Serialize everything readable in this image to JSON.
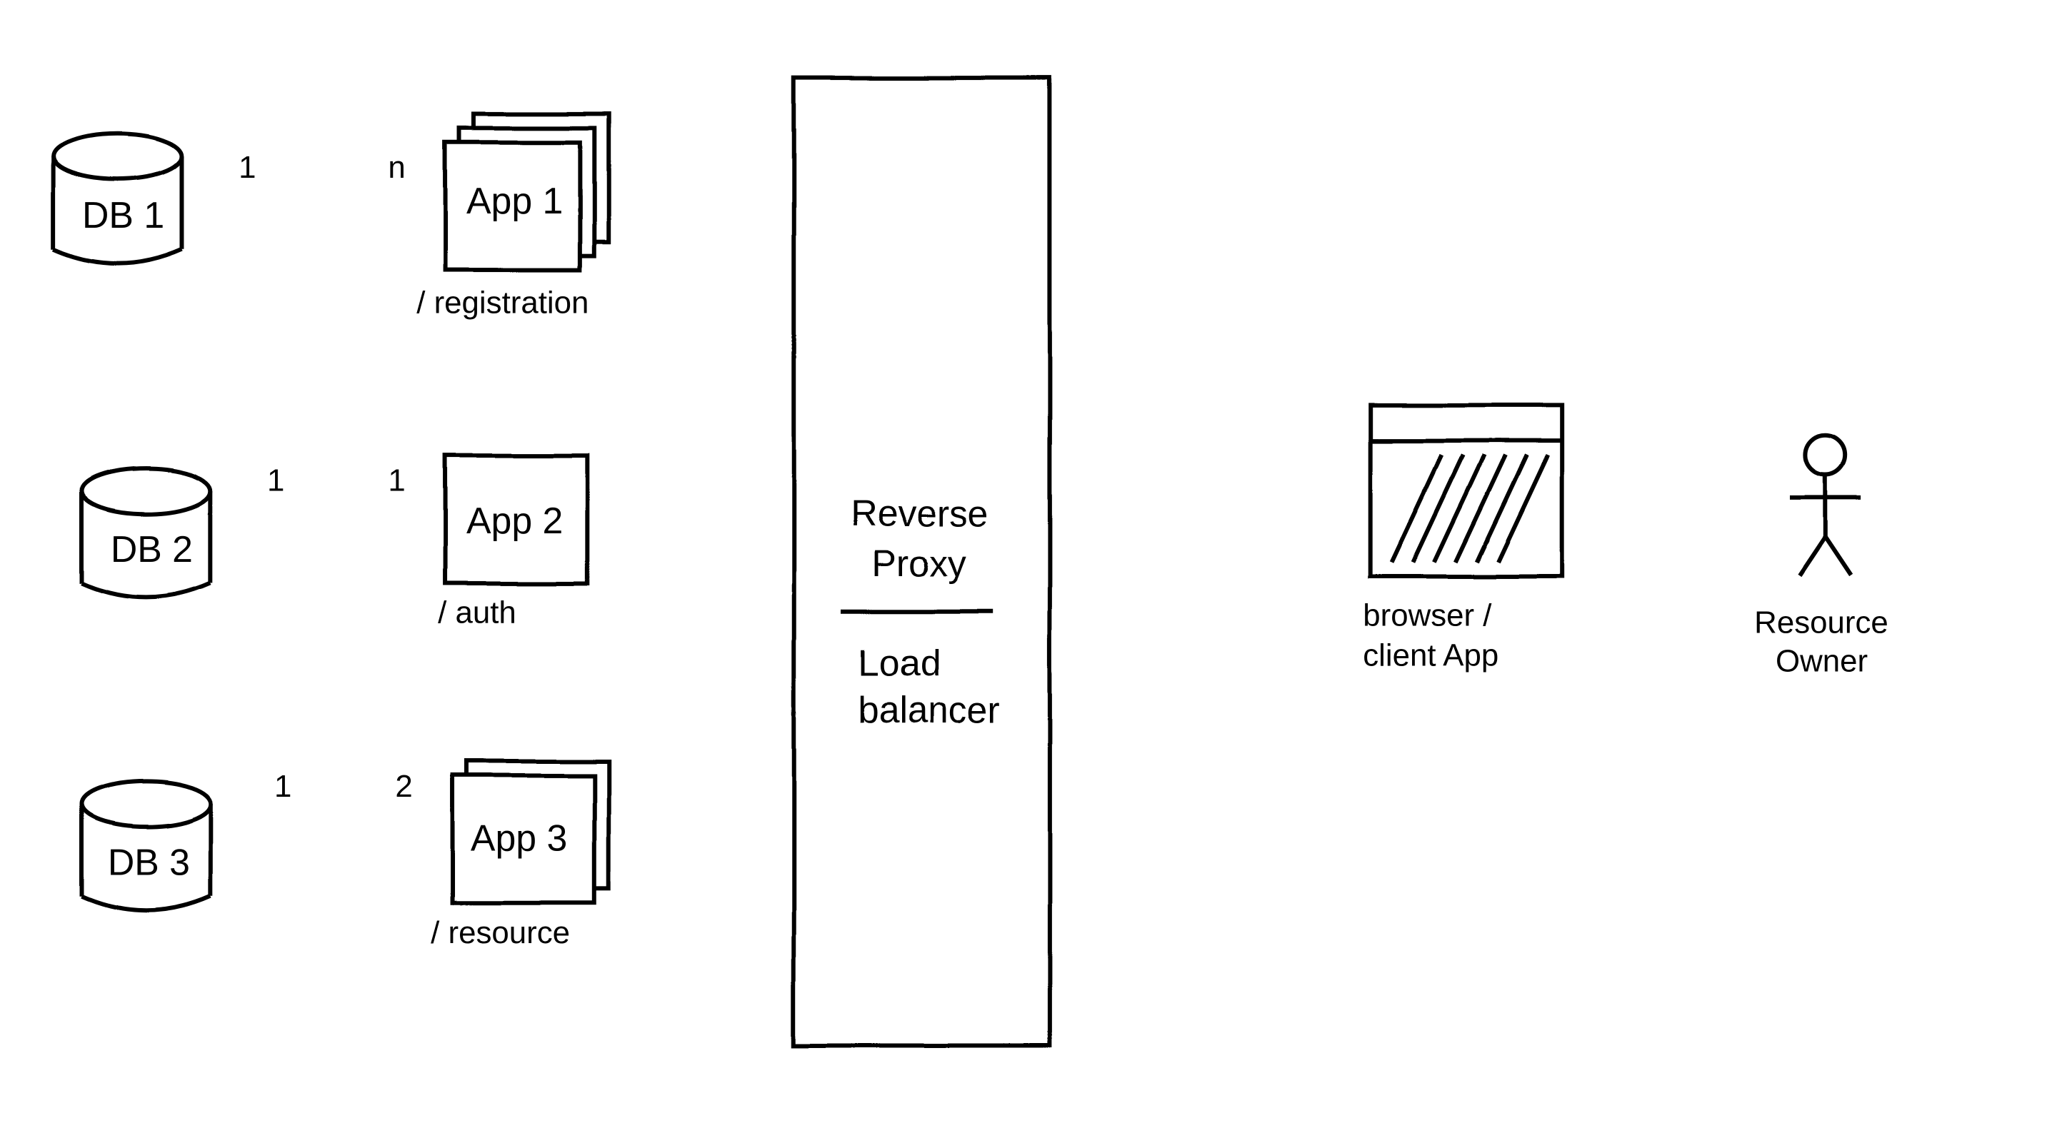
{
  "colors": {
    "ink": "#000000",
    "blue": "#0033cc",
    "red": "#e60000"
  },
  "dbs": [
    {
      "name": "DB 1"
    },
    {
      "name": "DB 2"
    },
    {
      "name": "DB 3"
    }
  ],
  "apps": [
    {
      "name": "App 1",
      "route": "/ registration",
      "instances": "n",
      "db_card": "1"
    },
    {
      "name": "App 2",
      "route": "/ auth",
      "instances": "1",
      "db_card": "1"
    },
    {
      "name": "App 3",
      "route": "/ resource",
      "instances": "2",
      "db_card": "1"
    }
  ],
  "proxy": {
    "line1": "Reverse",
    "line2": "Proxy",
    "line3": "Load",
    "line4": "balancer"
  },
  "client": {
    "line1": "browser /",
    "line2": "client App"
  },
  "owner": {
    "line1": "Resource",
    "line2": "Owner"
  },
  "cardinality": {
    "app1_left": "1",
    "app1_right": "n",
    "app2_left": "1",
    "app2_right": "1",
    "app3_left": "1",
    "app3_right": "2"
  }
}
